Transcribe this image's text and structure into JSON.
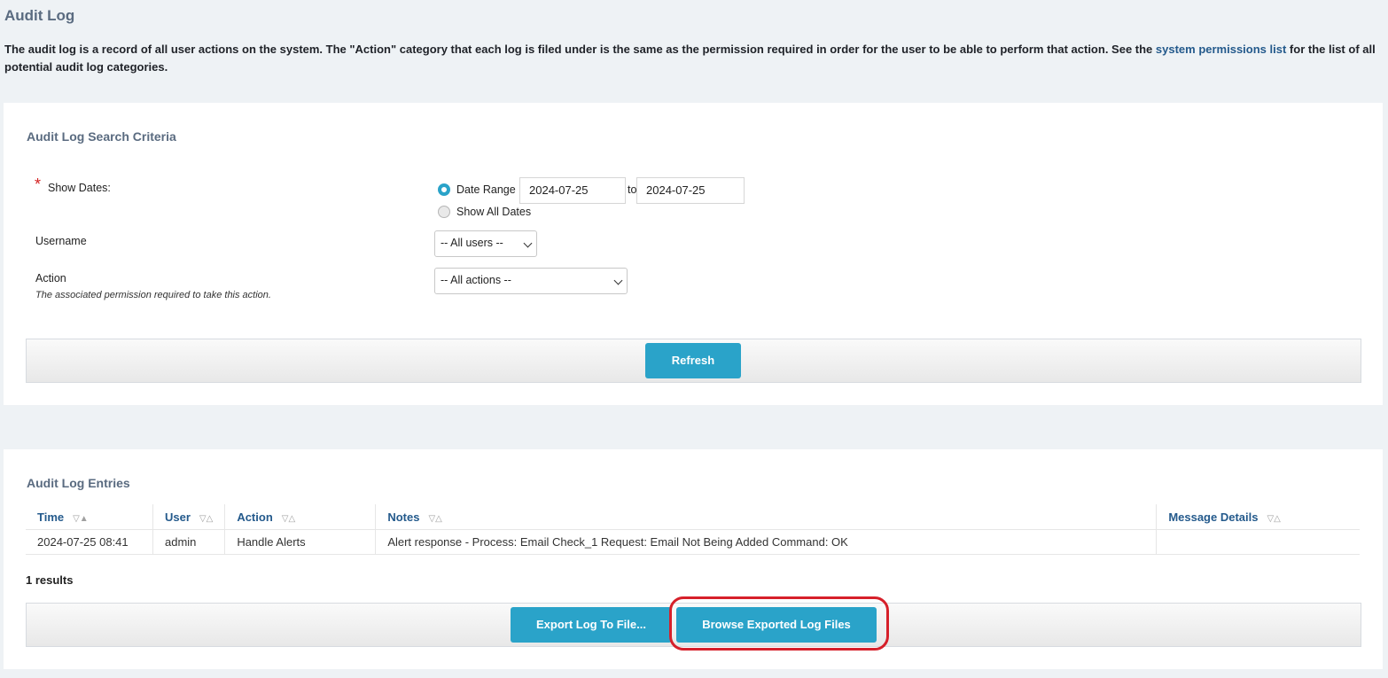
{
  "page": {
    "title": "Audit Log",
    "intro_part1": "The audit log is a record of all ",
    "intro_strong": "user",
    "intro_part2": " actions on the system. The \"Action\" category that each log is filed under is the same as the permission required in order for the user to be able to perform that action. See the ",
    "intro_link": "system permissions list",
    "intro_part3": " for the list of all potential audit log categories."
  },
  "search": {
    "title": "Audit Log Search Criteria",
    "show_dates_label": "Show Dates:",
    "required_mark": "*",
    "date_range_label": "Date Range",
    "date_from": "2024-07-25",
    "to_label": "to",
    "date_to": "2024-07-25",
    "show_all_label": "Show All Dates",
    "username_label": "Username",
    "username_selected": "-- All users --",
    "action_label": "Action",
    "action_hint": "The associated permission required to take this action.",
    "action_selected": "-- All actions --",
    "refresh_label": "Refresh"
  },
  "entries": {
    "title": "Audit Log Entries",
    "columns": [
      "Time",
      "User",
      "Action",
      "Notes",
      "Message Details"
    ],
    "sort_glyphs": [
      "▽▲",
      "▽△",
      "▽△",
      "▽△",
      "▽△"
    ],
    "rows": [
      {
        "time": "2024-07-25 08:41",
        "user": "admin",
        "action": "Handle Alerts",
        "notes": "Alert response - Process: Email Check_1 Request: Email Not Being Added Command: OK",
        "details": ""
      }
    ],
    "results_count": "1 results",
    "export_label": "Export Log To File...",
    "browse_label": "Browse Exported Log Files"
  },
  "colors": {
    "accent": "#2aa3c9",
    "highlight": "#d6202a"
  }
}
